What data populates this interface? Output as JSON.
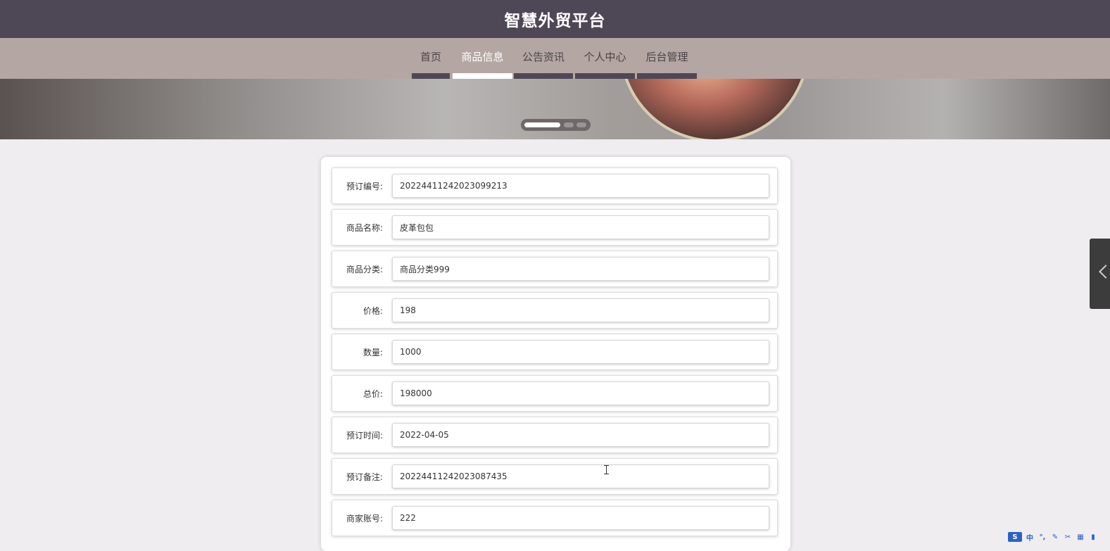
{
  "header": {
    "title": "智慧外贸平台"
  },
  "nav": {
    "items": [
      {
        "label": "首页"
      },
      {
        "label": "商品信息"
      },
      {
        "label": "公告资讯"
      },
      {
        "label": "个人中心"
      },
      {
        "label": "后台管理"
      }
    ],
    "active_index": 1
  },
  "banner": {
    "slide_count": 3,
    "active_slide": 1
  },
  "form": {
    "fields": [
      {
        "label": "预订编号:",
        "value": "20224411242023099213"
      },
      {
        "label": "商品名称:",
        "value": "皮革包包"
      },
      {
        "label": "商品分类:",
        "value": "商品分类999"
      },
      {
        "label": "价格:",
        "value": "198"
      },
      {
        "label": "数量:",
        "value": "1000"
      },
      {
        "label": "总价:",
        "value": "198000"
      },
      {
        "label": "预订时间:",
        "value": "2022-04-05"
      },
      {
        "label": "预订备注:",
        "value": "20224411242023087435"
      },
      {
        "label": "商家账号:",
        "value": "222"
      }
    ]
  },
  "side_panel": {
    "icon": "chevron-left-icon"
  },
  "ime_toolbar": {
    "items": [
      {
        "icon": "ime-logo-icon",
        "glyph": "S"
      },
      {
        "icon": "chinese-mode-icon",
        "glyph": "中"
      },
      {
        "icon": "punctuation-icon",
        "glyph": "°,"
      },
      {
        "icon": "handwriting-icon",
        "glyph": "✎"
      },
      {
        "icon": "tools-icon",
        "glyph": "✂"
      },
      {
        "icon": "keyboard-icon",
        "glyph": "▦"
      },
      {
        "icon": "skin-icon",
        "glyph": "▮"
      }
    ]
  },
  "colors": {
    "header_bg": "#4e4756",
    "nav_bg": "#b4a7a3",
    "page_bg": "#efedef",
    "active_underline": "#ffffff"
  }
}
